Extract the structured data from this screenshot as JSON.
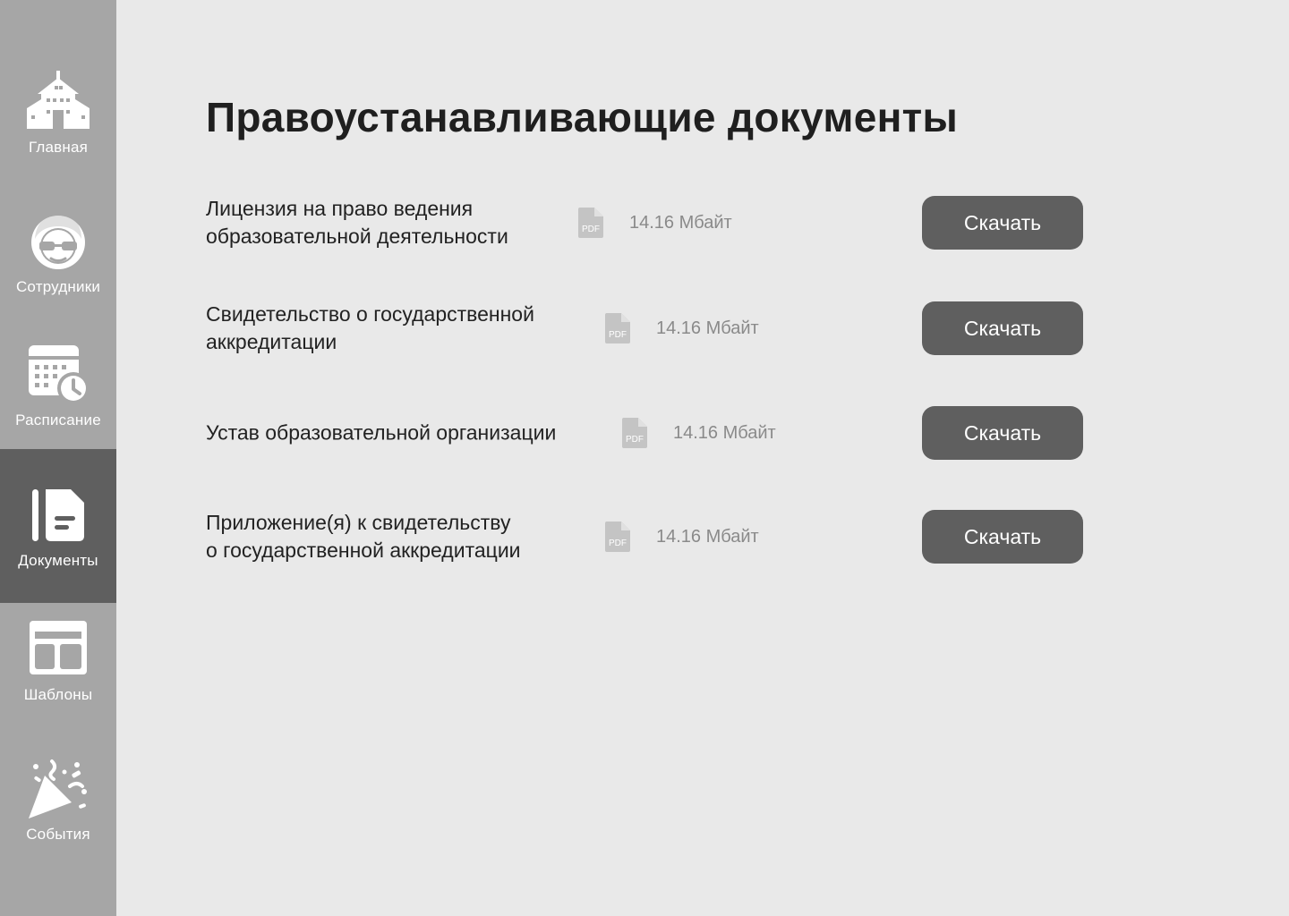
{
  "sidebar": {
    "items": [
      {
        "label": "Главная",
        "icon": "school-building-icon",
        "active": false
      },
      {
        "label": "Сотрудники",
        "icon": "person-glasses-icon",
        "active": false
      },
      {
        "label": "Расписание",
        "icon": "calendar-clock-icon",
        "active": false
      },
      {
        "label": "Документы",
        "icon": "document-icon",
        "active": true
      },
      {
        "label": "Шаблоны",
        "icon": "layout-template-icon",
        "active": false
      },
      {
        "label": "События",
        "icon": "party-popper-icon",
        "active": false
      }
    ]
  },
  "page": {
    "title": "Правоустанавливающие документы"
  },
  "documents": [
    {
      "title": "Лицензия на право ведения\nобразовательной деятельности",
      "file_type": "PDF",
      "size": "14.16 Мбайт",
      "button_label": "Скачать"
    },
    {
      "title": "Свидетельство о государственной\nаккредитации",
      "file_type": "PDF",
      "size": "14.16 Мбайт",
      "button_label": "Скачать"
    },
    {
      "title": "Устав образовательной организации",
      "file_type": "PDF",
      "size": "14.16 Мбайт",
      "button_label": "Скачать"
    },
    {
      "title": "Приложение(я) к свидетельству\nо государственной аккредитации",
      "file_type": "PDF",
      "size": "14.16 Мбайт",
      "button_label": "Скачать"
    }
  ],
  "colors": {
    "sidebar_bg": "#a6a6a6",
    "sidebar_active_bg": "#5f5f5f",
    "page_bg": "#e9e9e9",
    "button_bg": "#5f5f5f",
    "button_text": "#ffffff",
    "pdf_icon": "#c4c4c4"
  }
}
